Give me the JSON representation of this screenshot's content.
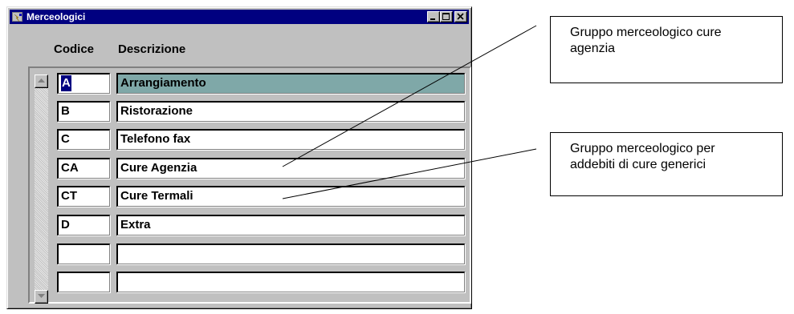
{
  "window": {
    "title": "Merceologici",
    "controls": {
      "minimize": "minimize",
      "maximize": "maximize",
      "close": "close"
    }
  },
  "table": {
    "columns": [
      "Codice",
      "Descrizione"
    ],
    "rows": [
      {
        "code": "A",
        "description": "Arrangiamento",
        "active": true
      },
      {
        "code": "B",
        "description": "Ristorazione"
      },
      {
        "code": "C",
        "description": "Telefono fax"
      },
      {
        "code": "CA",
        "description": "Cure Agenzia"
      },
      {
        "code": "CT",
        "description": "Cure Termali"
      },
      {
        "code": "D",
        "description": "Extra"
      },
      {
        "code": "",
        "description": ""
      },
      {
        "code": "",
        "description": ""
      }
    ]
  },
  "callouts": [
    {
      "lines": [
        "Gruppo merceologico cure",
        "agenzia"
      ]
    },
    {
      "lines": [
        "Gruppo merceologico per",
        "addebiti di cure generici"
      ]
    }
  ],
  "colors": {
    "titlebar": "#000080",
    "window_face": "#c0c0c0",
    "active_row": "#7fa8a8",
    "selection": "#000080"
  }
}
